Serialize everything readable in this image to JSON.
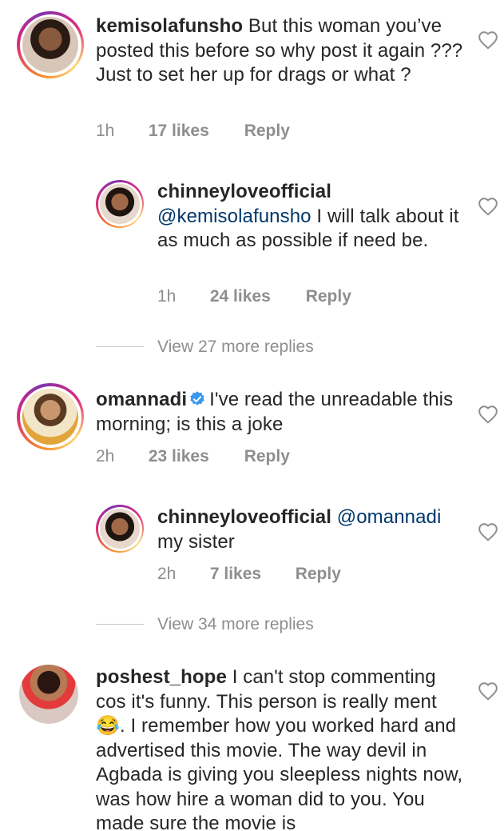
{
  "comments": [
    {
      "username": "kemisolafunsho",
      "text": "But this woman you’ve posted this before so why post it again ??? Just to set her up for drags or what ?",
      "time": "1h",
      "likes": "17 likes",
      "reply": "Reply"
    },
    {
      "username": "chinneyloveofficial",
      "mention": "@kemisolafunsho",
      "text": "I will talk about it as much as possible if need be.",
      "time": "1h",
      "likes": "24 likes",
      "reply": "Reply"
    },
    {
      "username": "omannadi",
      "text": "I've read the unreadable this  morning; is this a joke",
      "time": "2h",
      "likes": "23 likes",
      "reply": "Reply"
    },
    {
      "username": "chinneyloveofficial",
      "mention": "@omannadi",
      "text": "my sister",
      "time": "2h",
      "likes": "7 likes",
      "reply": "Reply"
    },
    {
      "username": "poshest_hope",
      "text_before_emoji": "I can't stop commenting cos it's funny. This person is really ment",
      "emoji": "😂",
      "text_after_emoji": ". I remember how you worked hard and advertised this movie. The way devil in Agbada is giving you sleepless nights now, was how hire a woman did to you. You made sure the movie is"
    }
  ],
  "view_more": [
    "View 27 more replies",
    "View 34 more replies"
  ],
  "icons": {
    "heart": "heart-outline-icon",
    "verified": "verified-badge-icon"
  },
  "colors": {
    "text": "#262626",
    "meta": "#8e8e8e",
    "mention": "#00376b",
    "verified": "#3897f0"
  }
}
